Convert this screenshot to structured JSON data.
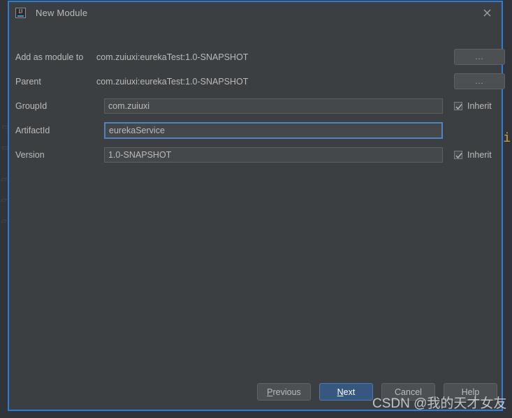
{
  "window": {
    "title": "New Module",
    "app_icon": "intellij-idea-icon",
    "close_icon": "close-icon",
    "accent_color": "#2d7cd6",
    "background_color": "#3c3f41"
  },
  "form": {
    "rows": [
      {
        "label": "Add as module to",
        "type": "static",
        "value": "com.zuiuxi:eurekaTest:1.0-SNAPSHOT",
        "browse_label": "..."
      },
      {
        "label": "Parent",
        "type": "static",
        "value": "com.zuiuxi:eurekaTest:1.0-SNAPSHOT",
        "browse_label": "..."
      },
      {
        "label": "GroupId",
        "type": "input",
        "value": "com.zuiuxi",
        "placeholder": "",
        "focused": false,
        "inherit_label": "Inherit",
        "inherit_checked": true
      },
      {
        "label": "ArtifactId",
        "type": "input",
        "value": "eurekaService",
        "placeholder": "",
        "focused": true,
        "inherit_label": "",
        "inherit_checked": false
      },
      {
        "label": "Version",
        "type": "input",
        "value": "1.0-SNAPSHOT",
        "placeholder": "",
        "focused": false,
        "inherit_label": "Inherit",
        "inherit_checked": true
      }
    ]
  },
  "footer": {
    "previous_label": "Previous",
    "previous_mnemonic": "P",
    "next_label": "Next",
    "next_mnemonic": "N",
    "cancel_label": "Cancel",
    "help_label": "Help",
    "primary_color": "#365880"
  },
  "overlay": {
    "watermark": "CSDN @我的天才女友"
  },
  "background": {
    "editor_glyph": "i"
  }
}
